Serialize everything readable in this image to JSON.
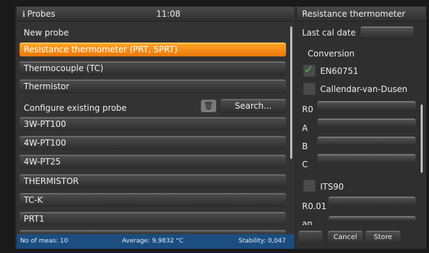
{
  "left_panel": {
    "icon": "info-icon",
    "title": "Probes",
    "time": "11:08",
    "new_probe_heading": "New probe",
    "new_probe_items": [
      "Resistance thermometer (PRT, SPRT)",
      "Thermocouple (TC)",
      "Thermistor"
    ],
    "existing_heading": "Configure existing probe",
    "search_label": "Search...",
    "existing_items": [
      "3W-PT100",
      "4W-PT100",
      "4W-PT25",
      "THERMISTOR",
      "TC-K",
      "PRT1"
    ]
  },
  "status": {
    "meas": "No of meas: 10",
    "average": "Average: 9,9832 °C",
    "stability": "Stability: 0,047"
  },
  "right_panel": {
    "title": "Resistance thermometer",
    "last_cal_label": "Last cal date",
    "conversion_label": "Conversion",
    "en60751_label": "EN60751",
    "en60751_checked": true,
    "cvd_label": "Callendar-van-Dusen",
    "cvd_checked": false,
    "coef_labels": [
      "R0",
      "A",
      "B",
      "C"
    ],
    "its90_label": "ITS90",
    "its90_checked": false,
    "r001_label": "R0.01",
    "an_label": "an",
    "cancel_label": "Cancel",
    "store_label": "Store"
  },
  "colors": {
    "selected": "#f58a14",
    "status_bar": "#1b4d80",
    "check": "#3ec43e"
  }
}
